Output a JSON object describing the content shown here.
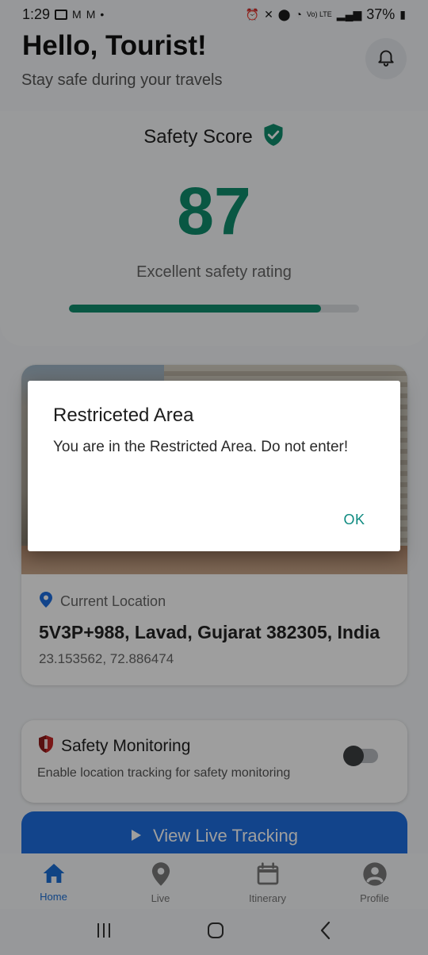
{
  "status_bar": {
    "time": "1:29",
    "battery": "37%",
    "network": "Vo) LTE"
  },
  "header": {
    "greeting": "Hello, Tourist!",
    "subtitle": "Stay safe during your travels"
  },
  "safety_score": {
    "title": "Safety Score",
    "value": "87",
    "rating": "Excellent safety rating",
    "progress_percent": 87,
    "accent_color": "#0f8d6d"
  },
  "location": {
    "label": "Current Location",
    "address": "5V3P+988, Lavad, Gujarat 382305, India",
    "coordinates": "23.153562, 72.886474"
  },
  "monitoring": {
    "title": "Safety Monitoring",
    "description": "Enable location tracking for safety monitoring",
    "enabled": false
  },
  "live_tracking": {
    "label": "View Live Tracking",
    "color": "#1e6fe0"
  },
  "bottom_nav": {
    "items": [
      {
        "label": "Home",
        "icon": "home-icon",
        "active": true
      },
      {
        "label": "Live",
        "icon": "location-pin-icon",
        "active": false
      },
      {
        "label": "Itinerary",
        "icon": "calendar-icon",
        "active": false
      },
      {
        "label": "Profile",
        "icon": "profile-icon",
        "active": false
      }
    ]
  },
  "dialog": {
    "title": "Restriceted Area",
    "message": "You are in the Restricted Area. Do not enter!",
    "ok_label": "OK"
  }
}
